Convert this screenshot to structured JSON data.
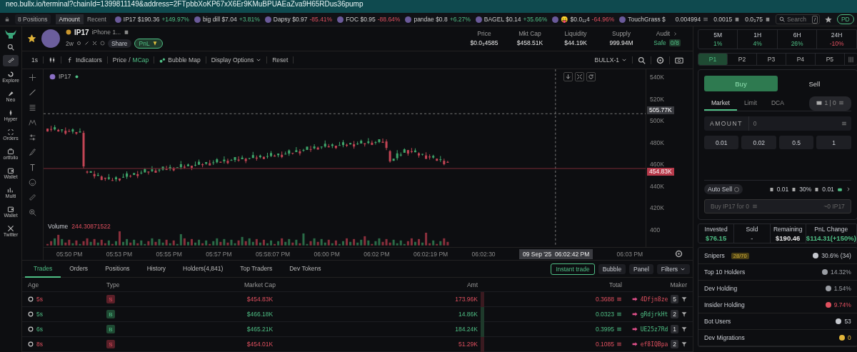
{
  "browser": {
    "url": "neo.bullx.io/terminal?chainId=1399811149&address=2FTpbbXoKP67xX6Er9KMuBPUAEaZva9H65RDus36pump"
  },
  "ticker_bar": {
    "positions": "8 Positions",
    "sort_tabs": [
      {
        "label": "Amount",
        "selected": true
      },
      {
        "label": "Recent",
        "selected": false
      }
    ],
    "tickers": [
      {
        "name": "IP17 $190.36",
        "change": "+149.97%",
        "negative": false
      },
      {
        "name": "big dill $7.04",
        "change": "+3.81%",
        "negative": false
      },
      {
        "name": "Dapsy $0.97",
        "change": "-85.41%",
        "negative": true
      },
      {
        "name": "FOC $0.95",
        "change": "-88.64%",
        "negative": true
      },
      {
        "name": "pandae $0.8",
        "change": "+6.27%",
        "negative": false
      },
      {
        "name": "BAGEL $0.14",
        "change": "+35.66%",
        "negative": false
      },
      {
        "name": "😛 $0.0₁₁4",
        "change": "-64.96%",
        "negative": true
      },
      {
        "name": "TouchGrass $"
      }
    ],
    "stats": [
      "0.004994",
      "0.0015",
      "0.0₃75"
    ],
    "search": {
      "placeholder": "Search",
      "shortcut": "/"
    },
    "account": "PD"
  },
  "sidebar": {
    "items": [
      {
        "selected": false
      },
      {
        "selected": true
      },
      {
        "label": "Explore",
        "selected": false
      },
      {
        "label": "Neo",
        "selected": false
      },
      {
        "label": "Hyper",
        "selected": false
      },
      {
        "label": "Orders",
        "selected": false
      },
      {
        "label": "ortfolio",
        "selected": false
      },
      {
        "label": "Wallet",
        "selected": false
      },
      {
        "label": "Multi",
        "selected": false
      },
      {
        "label": "Wallet",
        "selected": false
      },
      {
        "label": "Twitter",
        "selected": false
      }
    ]
  },
  "token": {
    "symbol": "IP17",
    "name": "iPhone 1...",
    "age": "2w",
    "share": "Share",
    "pnl": "PnL",
    "favorite": true,
    "stats": [
      {
        "label": "Price",
        "value": "$0.0₃4585"
      },
      {
        "label": "Mkt Cap",
        "value": "$458.51K"
      },
      {
        "label": "Liquidity",
        "value": "$44.19K"
      },
      {
        "label": "Supply",
        "value": "999.94M"
      }
    ],
    "audit": {
      "label": "Audit",
      "status": "Safe",
      "score": "0/8"
    }
  },
  "toolbar": {
    "interval": "1s",
    "indicators": "Indicators",
    "value_modes": [
      {
        "label": "Price",
        "selected": false
      },
      {
        "label": "MCap",
        "selected": true
      }
    ],
    "separator": "/",
    "bubble_map": "Bubble Map",
    "display_options": "Display Options",
    "reset": "Reset",
    "source": "BULLX-1"
  },
  "chart": {
    "legend": "IP17",
    "price_labels": [
      "540K",
      "520K",
      "500K",
      "480K",
      "460K",
      "440K",
      "420K",
      "400"
    ],
    "crosshair_price": "505.77K",
    "current_price": "454.83K",
    "volume_label": "Volume",
    "volume_value": "244.30871522",
    "time_labels": [
      "05:50 PM",
      "05:53 PM",
      "05:55 PM",
      "05:57 PM",
      "05:58:07 PM",
      "06:00 PM",
      "06:02 PM",
      "06:02:19 PM",
      "06:02:30"
    ],
    "crosshair_time": "09 Sep '25  06:02:42 PM",
    "last_time": "06:03 PM"
  },
  "bottom": {
    "tabs": [
      {
        "label": "Trades",
        "selected": true
      },
      {
        "label": "Orders",
        "selected": false
      },
      {
        "label": "Positions",
        "selected": false
      },
      {
        "label": "History",
        "selected": false
      },
      {
        "label": "Holders(4,841)",
        "selected": false
      },
      {
        "label": "Top Traders",
        "selected": false
      },
      {
        "label": "Dev Tokens",
        "selected": false
      }
    ],
    "buttons": {
      "instant_trade": "Instant trade",
      "bubble": "Bubble",
      "panel": "Panel",
      "filters": "Filters"
    },
    "columns": [
      "Age",
      "Type",
      "Market Cap",
      "Amt",
      "Total",
      "Maker"
    ],
    "rows": [
      {
        "age": "5s",
        "buy": false,
        "type": "S",
        "market_cap": "$454.83K",
        "amt": "173.96K",
        "total": "0.3688",
        "maker": "4Dfjn8ze",
        "count": "5"
      },
      {
        "age": "5s",
        "buy": true,
        "type": "B",
        "market_cap": "$466.18K",
        "amt": "14.86K",
        "total": "0.0323",
        "maker": "gRdjrkHt",
        "count": "2"
      },
      {
        "age": "6s",
        "buy": true,
        "type": "B",
        "market_cap": "$465.21K",
        "amt": "184.24K",
        "total": "0.3995",
        "maker": "UE25z7Rd",
        "count": "1"
      },
      {
        "age": "8s",
        "buy": false,
        "type": "S",
        "market_cap": "$454.01K",
        "amt": "51.29K",
        "total": "0.1085",
        "maker": "ef8IQBpa",
        "count": "2"
      }
    ]
  },
  "trade_panel": {
    "timeframes": [
      {
        "label": "5M",
        "change": "1%",
        "negative": false
      },
      {
        "label": "1H",
        "change": "4%",
        "negative": false
      },
      {
        "label": "6H",
        "change": "26%",
        "negative": false
      },
      {
        "label": "24H",
        "change": "-10%",
        "negative": true
      }
    ],
    "presets": [
      {
        "label": "P1",
        "selected": true
      },
      {
        "label": "P2",
        "selected": false
      },
      {
        "label": "P3",
        "selected": false
      },
      {
        "label": "P4",
        "selected": false
      },
      {
        "label": "P5",
        "selected": false
      }
    ],
    "sides": [
      {
        "label": "Buy",
        "selected": true
      },
      {
        "label": "Sell",
        "selected": false
      }
    ],
    "order_types": [
      {
        "label": "Market",
        "selected": true
      },
      {
        "label": "Limit",
        "selected": false
      },
      {
        "label": "DCA",
        "selected": false
      }
    ],
    "wallets": "1 | 0",
    "amount_label": "AMOUNT",
    "amount_placeholder": "0",
    "quick_amounts": [
      "0.01",
      "0.02",
      "0.5",
      "1"
    ],
    "auto_sell": {
      "label": "Auto Sell",
      "on": false
    },
    "settings": [
      "0.01",
      "30%",
      "0.01"
    ],
    "submit": "Buy IP17 for 0",
    "receive": "~0 IP17"
  },
  "position": [
    {
      "label": "Invested",
      "value": "$76.15",
      "color": "#4fbf85"
    },
    {
      "label": "Sold",
      "value": "-"
    },
    {
      "label": "Remaining",
      "value": "$190.46",
      "color": "#e8e8e8"
    },
    {
      "label": "PnL Change",
      "value": "$114.31(+150%)",
      "color": "#4fbf85"
    }
  ],
  "holders": [
    {
      "label": "Snipers",
      "badge": "28/70",
      "value": "30.6% (34)",
      "color": "#c5c8ce"
    },
    {
      "label": "Top 10 Holders",
      "value": "14.32%",
      "color": "#9a9da3"
    },
    {
      "label": "Dev Holding",
      "value": "1.54%",
      "color": "#9a9da3"
    },
    {
      "label": "Insider Holding",
      "value": "9.74%",
      "color": "#e0505f"
    },
    {
      "label": "Bot Users",
      "value": "53",
      "color": "#c5c8ce"
    },
    {
      "label": "Dev Migrations",
      "value": "0",
      "color": "#e0b43a"
    }
  ]
}
